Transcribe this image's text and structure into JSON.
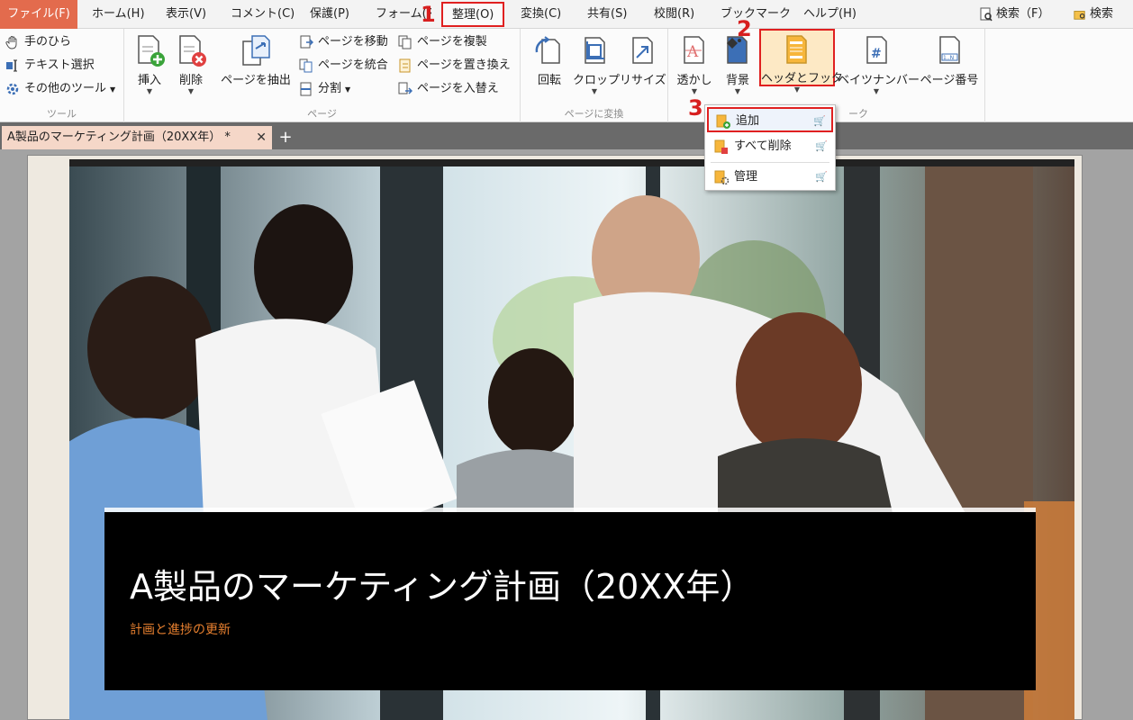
{
  "menubar": {
    "file": "ファイル(F)",
    "items": [
      "ホーム(H)",
      "表示(V)",
      "コメント(C)",
      "保護(P)",
      "フォーム(R)",
      "整理(O)",
      "変換(C)",
      "共有(S)",
      "校閲(R)",
      "ブックマーク",
      "ヘルプ(H)"
    ],
    "search_f": "検索（F）",
    "search": "検索"
  },
  "ribbon": {
    "tools": {
      "hand": "手のひら",
      "text_select": "テキスト選択",
      "other_tools": "その他のツール",
      "label": "ツール"
    },
    "page": {
      "insert": "挿入",
      "delete": "削除",
      "extract": "ページを抽出",
      "move": "ページを移動",
      "merge": "ページを統合",
      "split": "分割",
      "duplicate": "ページを複製",
      "replace": "ページを置き換え",
      "swap": "ページを入替え",
      "label": "ページ"
    },
    "transform": {
      "rotate": "回転",
      "crop": "クロップ",
      "resize": "リサイズ",
      "label": "ページに変換"
    },
    "mark": {
      "watermark": "透かし",
      "background": "背景",
      "header_footer": "ヘッダとフッタ",
      "bates": "ベイツナンバー",
      "page_number": "ページ番号",
      "label": "ーク"
    }
  },
  "steps": [
    "1",
    "2",
    "3"
  ],
  "tab": {
    "title": "A製品のマーケティング計画（20XX年） *",
    "close": "✕",
    "add": "+"
  },
  "dropdown": {
    "add": "追加",
    "delete_all": "すべて削除",
    "manage": "管理"
  },
  "slide": {
    "title": "A製品のマーケティング計画（20XX年）",
    "subtitle": "計画と進捗の更新"
  },
  "colors": {
    "file_menu": "#e36b4d",
    "highlight": "#e02020",
    "subtitle": "#e8802f"
  }
}
